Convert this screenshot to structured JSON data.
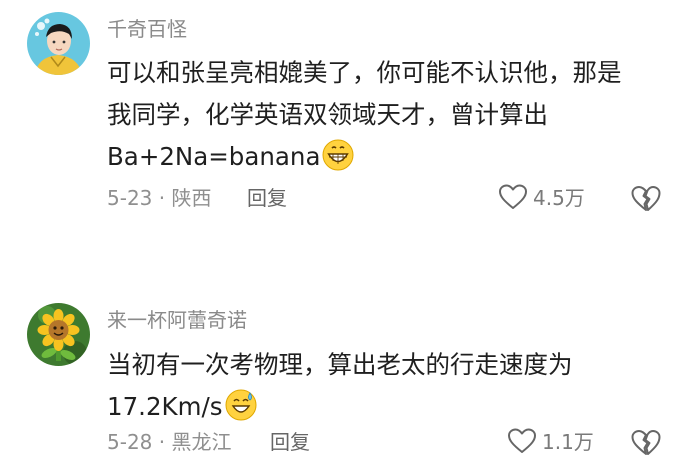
{
  "comments": [
    {
      "username": "千奇百怪",
      "lines": [
        "可以和张呈亮相媲美了，你可能不认识他，那是",
        "我同学，化学英语双领域天才，曾计算出",
        "Ba+2Na=banana"
      ],
      "emoji": "grinning-face",
      "date_location": "5-23 · 陕西",
      "reply_label": "回复",
      "like_count": "4.5万",
      "avatar_bg": "#67c7e0"
    },
    {
      "username": "来一杯阿蕾奇诺",
      "lines": [
        "当初有一次考物理，算出老太的行走速度为",
        "17.2Km/s"
      ],
      "emoji": "sweat-smile-face",
      "date_location": "5-28 · 黑龙江",
      "reply_label": "回复",
      "like_count": "1.1万",
      "avatar_bg": "#3e7a2f"
    }
  ],
  "colors": {
    "username": "#8a8a8a",
    "body_text": "#1f1f1f",
    "meta_text": "#8f8f8f",
    "icon_stroke": "#666666"
  }
}
